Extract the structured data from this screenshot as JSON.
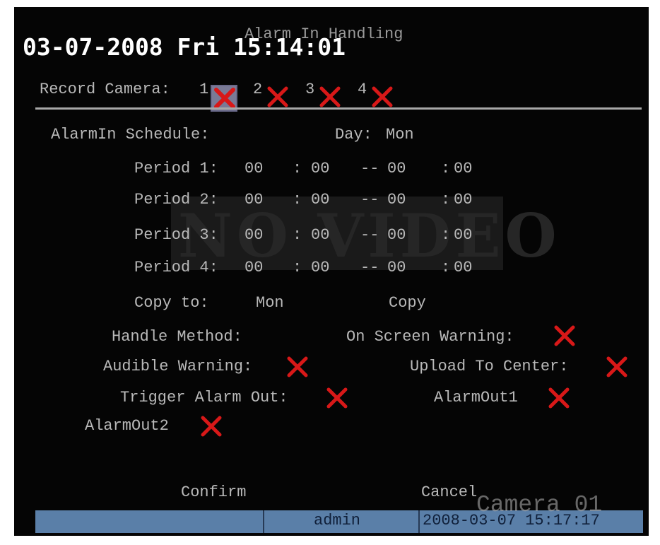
{
  "header": {
    "title": "Alarm In Handling",
    "datetime": "03-07-2008 Fri 15:14:01"
  },
  "record_camera": {
    "label": "Record Camera:",
    "cameras": [
      "1",
      "2",
      "3",
      "4"
    ]
  },
  "schedule": {
    "label": "AlarmIn Schedule:",
    "day_label": "Day:",
    "day_value": "Mon",
    "periods": [
      {
        "label": "Period 1:",
        "start_h": "00",
        "sep1": ":",
        "start_m": "00",
        "dash": "--",
        "end_h": "00",
        "sep2": ":",
        "end_m": "00"
      },
      {
        "label": "Period 2:",
        "start_h": "00",
        "sep1": ":",
        "start_m": "00",
        "dash": "--",
        "end_h": "00",
        "sep2": ":",
        "end_m": "00"
      },
      {
        "label": "Period 3:",
        "start_h": "00",
        "sep1": ":",
        "start_m": "00",
        "dash": "--",
        "end_h": "00",
        "sep2": ":",
        "end_m": "00"
      },
      {
        "label": "Period 4:",
        "start_h": "00",
        "sep1": ":",
        "start_m": "00",
        "dash": "--",
        "end_h": "00",
        "sep2": ":",
        "end_m": "00"
      }
    ],
    "copy_to_label": "Copy to:",
    "copy_to_value": "Mon",
    "copy_button": "Copy"
  },
  "handle": {
    "method_label": "Handle Method:",
    "on_screen_warning": "On Screen Warning:",
    "audible_warning": "Audible Warning:",
    "upload_to_center": "Upload To Center:",
    "trigger_alarm_out": "Trigger Alarm Out:",
    "alarm_out1": "AlarmOut1",
    "alarm_out2": "AlarmOut2"
  },
  "buttons": {
    "confirm": "Confirm",
    "cancel": "Cancel"
  },
  "overlay": {
    "no_video": "NO VIDEO",
    "camera": "Camera 01"
  },
  "status_bar": {
    "user": "admin",
    "timestamp": "2008-03-07 15:17:17"
  },
  "colors": {
    "checkbox_x": "#d81818",
    "status_bar": "#5a7fa8",
    "osd_text": "#b9b9b9"
  }
}
